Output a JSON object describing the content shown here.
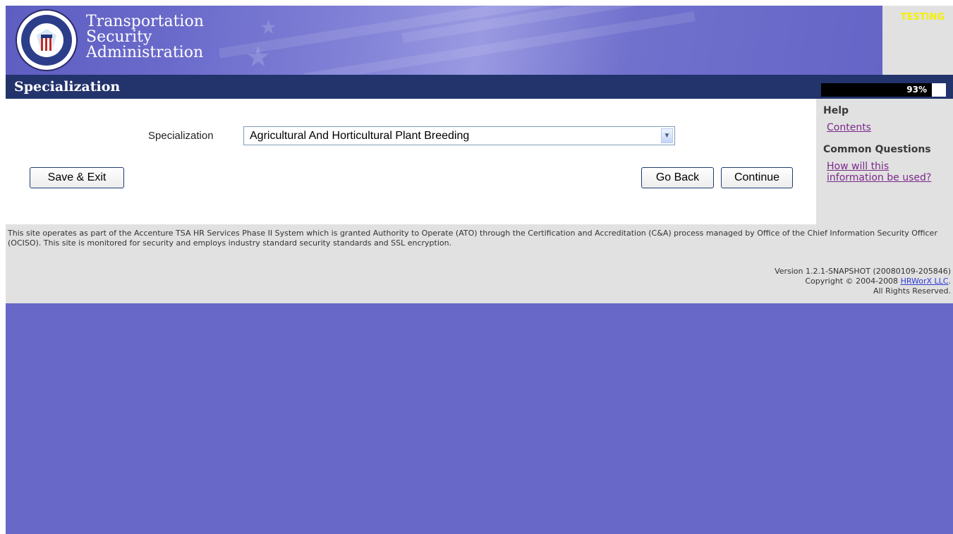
{
  "header": {
    "agency_lines": [
      "Transportation",
      "Security",
      "Administration"
    ],
    "seal_text": "U.S. DEPARTMENT OF HOMELAND SECURITY",
    "environment_badge": "TESTING"
  },
  "page": {
    "title": "Specialization",
    "progress": {
      "percent_label": "93%",
      "fraction": 0.93
    }
  },
  "form": {
    "specialization": {
      "label": "Specialization",
      "selected": "Agricultural And Horticultural Plant Breeding"
    },
    "buttons": {
      "save_exit": "Save & Exit",
      "go_back": "Go Back",
      "continue": "Continue"
    }
  },
  "help": {
    "heading": "Help",
    "contents_link": "Contents",
    "common_questions_heading": "Common Questions",
    "question_link": "How will this information be used?"
  },
  "footer": {
    "notice": "This site operates as part of the Accenture TSA HR Services Phase II System which is granted Authority to Operate (ATO) through the Certification and Accreditation (C&A) process managed by Office of the Chief Information Security Officer (OCISO). This site is monitored for security and employs industry standard security standards and SSL encryption.",
    "version": "Version 1.2.1-SNAPSHOT (20080109-205846)",
    "copyright_prefix": "Copyright © 2004-2008",
    "company_link": "HRWorX LLC",
    "rights": "All Rights Reserved."
  },
  "colors": {
    "page_background": "#6868c8",
    "title_bar": "#23336c",
    "sidebar": "#e1e1e1",
    "testing_badge": "#f5f000",
    "help_link": "#7a2a8a"
  }
}
